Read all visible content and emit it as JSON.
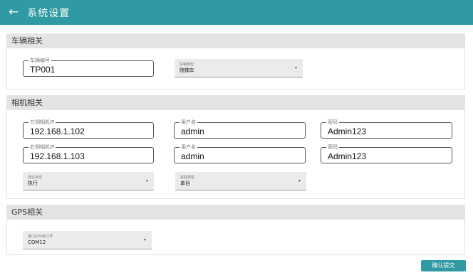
{
  "header": {
    "back_icon": "←",
    "title": "系统设置"
  },
  "sections": {
    "vehicle": {
      "title": "车辆相关",
      "vehicle_no": {
        "label": "车辆编号",
        "value": "TP001"
      },
      "vehicle_type": {
        "label": "车辆类型",
        "value": "随捕车"
      }
    },
    "camera": {
      "title": "相机相关",
      "left_ip": {
        "label": "左侧相机IP",
        "value": "192.168.1.102"
      },
      "left_user": {
        "label": "用户名",
        "value": "admin"
      },
      "left_pwd": {
        "label": "密码",
        "value": "Admin123"
      },
      "right_ip": {
        "label": "右侧相机IP",
        "value": "192.168.1.103"
      },
      "right_user": {
        "label": "用户名",
        "value": "admin"
      },
      "right_pwd": {
        "label": "密码",
        "value": "Admin123"
      },
      "debug_state": {
        "label": "调试状态",
        "value": "执行"
      },
      "capture_type": {
        "label": "获取类型",
        "value": "单目"
      }
    },
    "gps": {
      "title": "GPS相关",
      "port": {
        "label": "串口GPS串口号",
        "value": "COM12"
      }
    }
  },
  "submit_label": "确认提交",
  "dropdown_icon": "▾",
  "colors": {
    "header": "#2f9aa3",
    "section_head": "#e4e4e4",
    "select_bg": "#ebebeb"
  }
}
